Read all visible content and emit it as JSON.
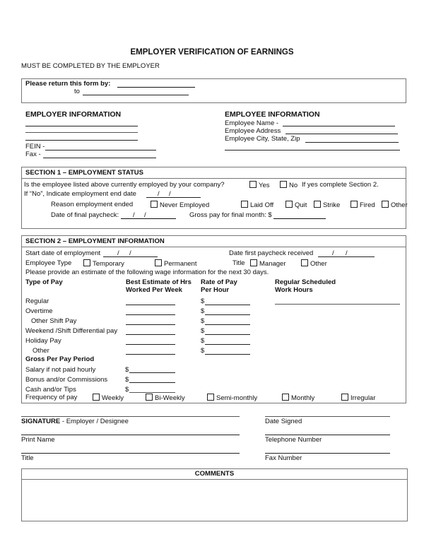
{
  "title": "EMPLOYER VERIFICATION OF EARNINGS",
  "subtitle": "MUST BE COMPLETED BY THE EMPLOYER",
  "return_box": {
    "label": "Please return this form by:",
    "to_label": "to",
    "return_by_value": "",
    "to_value": ""
  },
  "employer_info": {
    "heading": "EMPLOYER INFORMATION",
    "fein_label": "FEIN -",
    "fax_label": "Fax -"
  },
  "employee_info": {
    "heading": "EMPLOYEE INFORMATION",
    "name_label": "Employee Name -",
    "address_label": "Employee Address",
    "city_label": "Employee City, State, Zip"
  },
  "section1": {
    "heading": "SECTION 1 – EMPLOYMENT STATUS",
    "question": "Is the employee listed above currently employed by your company?",
    "yes_label": "Yes",
    "no_label": "No",
    "yes_note": "If yes complete Section 2.",
    "end_date_label": "If  “No”, Indicate employment end date",
    "reason_label": "Reason employment ended",
    "reasons": [
      "Never Employed",
      "Laid Off",
      "Quit",
      "Strike",
      "Fired",
      "Other"
    ],
    "final_paycheck_label": "Date of final paycheck:",
    "gross_final_label": "Gross pay for final month: $",
    "date_slash": "/"
  },
  "section2": {
    "heading": "SECTION 2 – EMPLOYMENT INFORMATION",
    "start_date_label": "Start date of employment",
    "first_paycheck_label": "Date first paycheck received",
    "employee_type_label": "Employee Type",
    "employee_types": [
      "Temporary",
      "Permanent"
    ],
    "title_label": "Title",
    "title_options": [
      "Manager",
      "Other"
    ],
    "estimate_note": "Please provide an estimate of the following wage information for the next 30 days.",
    "col_type": "Type of Pay",
    "col_hours_1": "Best Estimate of Hrs",
    "col_hours_2": "Worked Per Week",
    "col_rate_1": "Rate of Pay",
    "col_rate_2": "Per Hour",
    "col_sched_1": "Regular Scheduled",
    "col_sched_2": "Work Hours",
    "dollar": "$",
    "pay_rows": [
      "Regular",
      "Overtime",
      "Other Shift Pay",
      "Weekend /Shift Differential pay",
      "Holiday Pay",
      "Other"
    ],
    "gross_heading": "Gross Per Pay Period",
    "gross_rows": [
      "Salary if not paid hourly",
      "Bonus and/or Commissions",
      "Cash and/or Tips"
    ],
    "frequency_label": "Frequency of pay",
    "frequencies": [
      "Weekly",
      "Bi-Weekly",
      "Semi-monthly",
      "Monthly",
      "Irregular"
    ]
  },
  "signature": {
    "signature_bold": "SIGNATURE",
    "signature_rest": " - Employer / Designee",
    "date_signed": "Date Signed",
    "print_name": "Print Name",
    "telephone": "Telephone Number",
    "title": "Title",
    "fax_number": "Fax Number"
  },
  "comments": {
    "heading": "COMMENTS",
    "value": ""
  }
}
